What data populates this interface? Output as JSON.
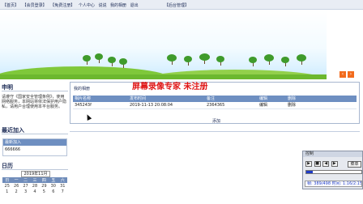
{
  "nav": {
    "items": [
      "【首页】",
      "【会员登录】",
      "【免费注册】",
      "个人中心",
      "说说",
      "我的相册",
      "退出"
    ],
    "admin": "【后台管理】"
  },
  "banner": {
    "prev": "‹",
    "next": "›"
  },
  "left": {
    "notice_title": "申明",
    "notice_text": "请遵守《国家安全管理条例》，使用网络服务，本网站将依法保护用户隐私，请用户合理使用本平台服务。",
    "recent_title": "最近加入",
    "recent_header": "最新加入",
    "recent_item": "666666",
    "calendar_title": "日历",
    "calendar_year_month": "2019年11月",
    "calendar_weekdays": [
      "日",
      "一",
      "二",
      "三",
      "四",
      "五",
      "六"
    ],
    "calendar_row1": [
      "25",
      "26",
      "27",
      "28",
      "29",
      "30",
      "31"
    ],
    "calendar_row2": [
      "1",
      "2",
      "3",
      "4",
      "5",
      "6",
      "7"
    ]
  },
  "main": {
    "panel_title": "我的相册",
    "watermark": "屏幕录像专家 未注册",
    "columns": [
      "相片名称",
      "发布时间",
      "备注",
      "编辑",
      "删除"
    ],
    "rows": [
      {
        "name": "345243f",
        "time": "2019-11-13 20:08:04",
        "note": "2364365",
        "edit": "编辑",
        "delete": "删除"
      }
    ],
    "add_label": "添加"
  },
  "control": {
    "title": "控制",
    "buttons": [
      "▶",
      "■",
      "◀",
      "▶"
    ],
    "menu_label": "菜单",
    "progress": 0.12,
    "status": "帧: 389/498 时间: 1:16/2:15"
  },
  "colors": {
    "accent": "#6e8fc1",
    "watermark": "#e01616",
    "arrow": "#f26b1d"
  }
}
